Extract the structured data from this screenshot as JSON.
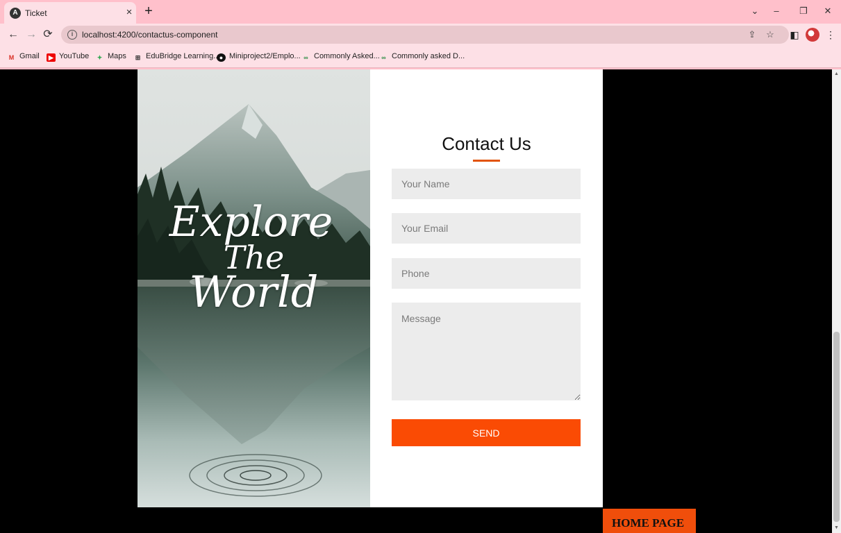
{
  "browser": {
    "tab": {
      "title": "Ticket",
      "favicon": "angular-icon"
    },
    "url": "localhost:4200/contactus-component",
    "bookmarks": [
      {
        "label": "Gmail",
        "icon": "gmail-icon"
      },
      {
        "label": "YouTube",
        "icon": "youtube-icon"
      },
      {
        "label": "Maps",
        "icon": "maps-icon"
      },
      {
        "label": "EduBridge Learning...",
        "icon": "edubridge-icon"
      },
      {
        "label": "Miniproject2/Emplo...",
        "icon": "github-icon"
      },
      {
        "label": "Commonly Asked...",
        "icon": "geeksforgeeks-icon"
      },
      {
        "label": "Commonly asked D...",
        "icon": "geeksforgeeks-icon"
      }
    ]
  },
  "hero": {
    "lines": [
      "Explore",
      "The",
      "World"
    ]
  },
  "form": {
    "title": "Contact Us",
    "name_placeholder": "Your Name",
    "email_placeholder": "Your Email",
    "phone_placeholder": "Phone",
    "message_placeholder": "Message",
    "send_label": "SEND"
  },
  "home_button": "HOME PAGE",
  "colors": {
    "chrome": "#ffc0cb",
    "accent": "#fa4b04",
    "field_bg": "#ececec",
    "page_bg": "#000000"
  }
}
